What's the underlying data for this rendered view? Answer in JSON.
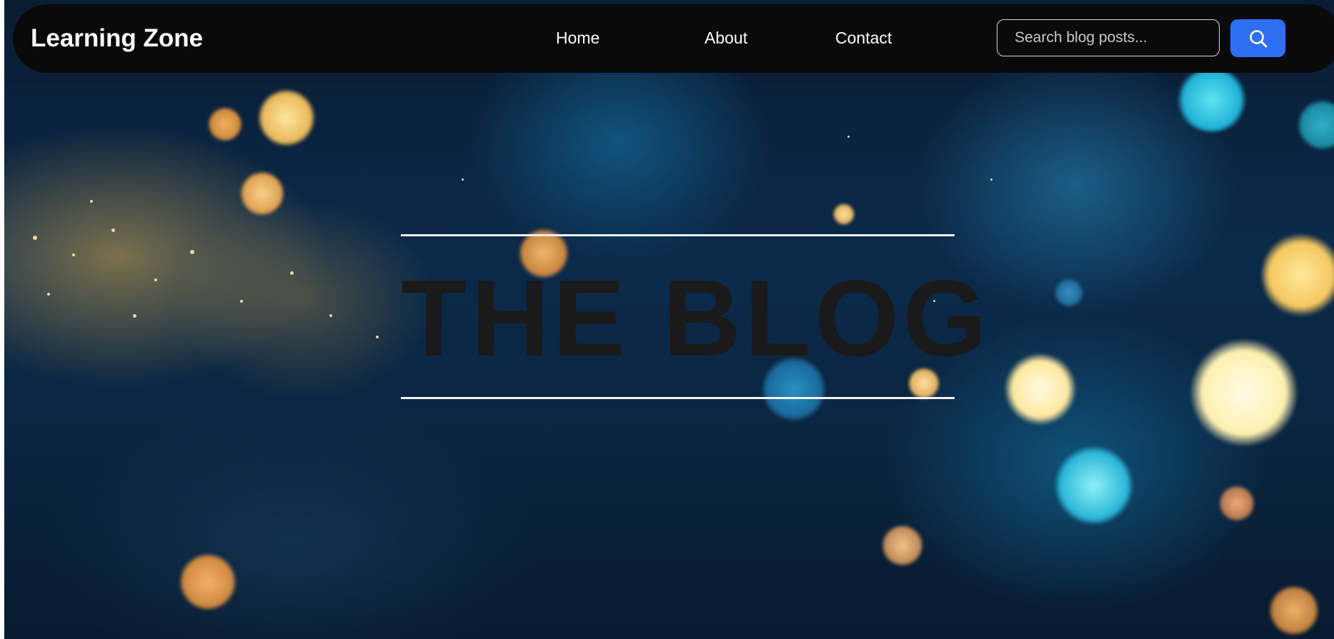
{
  "navbar": {
    "logo": "Learning Zone",
    "links": [
      {
        "label": "Home"
      },
      {
        "label": "About"
      },
      {
        "label": "Contact"
      }
    ],
    "search": {
      "placeholder": "Search blog posts...",
      "value": "",
      "button_icon": "search-icon"
    }
  },
  "hero": {
    "title": "THE BLOG",
    "background": "gold and blue bokeh glitter"
  },
  "colors": {
    "navbar_bg": "#0a0a0a",
    "accent": "#2f6ff2",
    "title_text": "#1a1a1a",
    "rule": "#f2f2f2"
  }
}
